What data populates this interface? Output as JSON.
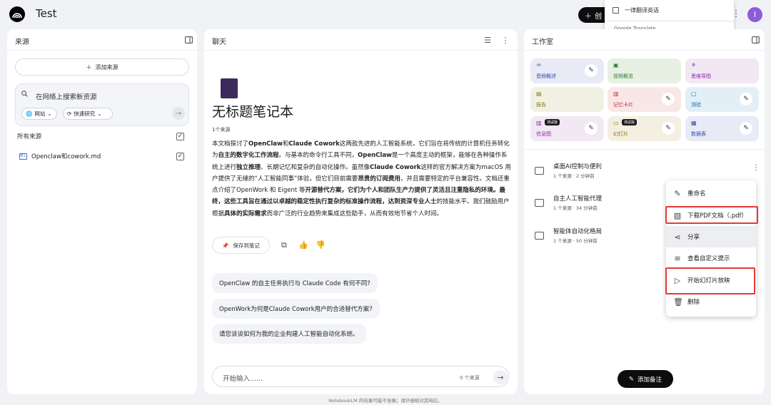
{
  "app": {
    "title": "Test",
    "avatar_initial": "I",
    "create_label": "创"
  },
  "translate_popup": {
    "option": "一律翻译英语",
    "brand": "Google Translate"
  },
  "sources": {
    "title": "来源",
    "add_label": "添加来源",
    "search_placeholder": "在网络上搜索新资源",
    "chip_web": "网站",
    "chip_research": "快速研究",
    "all_label": "所有来源",
    "items": [
      {
        "name": "Openclaw和cowork.md",
        "icon": "md-icon"
      }
    ]
  },
  "chat": {
    "title": "聊天",
    "notebook_title": "无标题笔记本",
    "source_count": "1个来源",
    "save_note": "保存到笔记",
    "suggestions": [
      "OpenClaw 的自主任务执行与 Claude Code 有何不同?",
      "OpenWork为何是Claude Cowork用户的合适替代方案?",
      "请您谈谈如何为我的企业构建人工智能自动化系统。"
    ],
    "input_placeholder": "开始输入......",
    "input_count": "0 个来源"
  },
  "studio": {
    "title": "工作室",
    "tiles": [
      {
        "label": "音频概述",
        "icon": "audio-icon",
        "bg": "#e8eaf6",
        "color": "#3949ab"
      },
      {
        "label": "视频概览",
        "icon": "video-icon",
        "bg": "#e6f1e3",
        "color": "#2e7d32"
      },
      {
        "label": "思维导图",
        "icon": "mindmap-icon",
        "bg": "#f1e8f3",
        "color": "#8e24aa"
      },
      {
        "label": "报告",
        "icon": "report-icon",
        "bg": "#f1f1e3",
        "color": "#827717"
      },
      {
        "label": "记忆卡片",
        "icon": "flashcard-icon",
        "bg": "#f9e7e7",
        "color": "#c62828"
      },
      {
        "label": "测验",
        "icon": "quiz-icon",
        "bg": "#e3eff6",
        "color": "#1565c0"
      },
      {
        "label": "信息图",
        "icon": "infographic-icon",
        "bg": "#f1e8f3",
        "color": "#8e24aa",
        "beta": "测试版"
      },
      {
        "label": "幻灯片",
        "icon": "slides-icon",
        "bg": "#f3efe2",
        "color": "#8d6e00",
        "beta": "测试版"
      },
      {
        "label": "数据表",
        "icon": "table-icon",
        "bg": "#e8eaf6",
        "color": "#3949ab"
      }
    ],
    "notes": [
      {
        "title": "桌面AI控制与便利",
        "meta": "1 个来源 · 2 分钟前"
      },
      {
        "title": "自主人工智能代理",
        "meta": "1 个来源 · 34 分钟前"
      },
      {
        "title": "智能体自动化格局",
        "meta": "1 个来源 · 50 分钟前"
      }
    ],
    "add_note": "添加备注"
  },
  "menu": {
    "items": [
      {
        "label": "重命名",
        "icon": "pencil-icon"
      },
      {
        "label": "下载PDF文档（.pdf）",
        "icon": "pdf-icon"
      },
      {
        "label": "分享",
        "icon": "share-icon"
      },
      {
        "label": "查看自定义提示",
        "icon": "prompt-icon"
      },
      {
        "label": "开始幻灯片放映",
        "icon": "play-icon"
      },
      {
        "label": "删除",
        "icon": "trash-icon"
      }
    ]
  },
  "footer": "NotebookLM 的结果可能不准确；请仔细核对其响应。"
}
